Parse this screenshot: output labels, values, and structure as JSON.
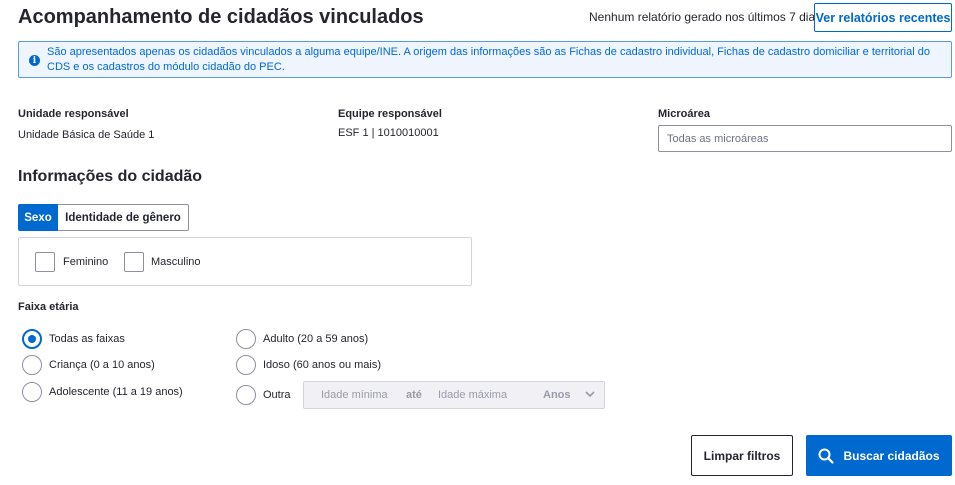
{
  "header": {
    "title": "Acompanhamento de cidadãos vinculados",
    "report_note": "Nenhum relatório gerado nos últimos 7 dias",
    "recent_reports_label": "Ver relatórios recentes"
  },
  "alert": {
    "icon": "info-icon",
    "text": "São apresentados apenas os cidadãos vinculados a alguma equipe/INE. A origem das informações são as Fichas de cadastro individual, Fichas de cadastro domiciliar e territorial do CDS e os cadastros do módulo cidadão do PEC."
  },
  "filters": {
    "unit": {
      "label": "Unidade responsável",
      "value": "Unidade Básica de Saúde 1"
    },
    "team": {
      "label": "Equipe responsável",
      "value": "ESF 1 | 1010010001"
    },
    "microarea": {
      "label": "Microárea",
      "placeholder": "Todas as microáreas"
    }
  },
  "citizen": {
    "section_title": "Informações do cidadão",
    "tabs": [
      {
        "label": "Sexo",
        "active": true
      },
      {
        "label": "Identidade de gênero",
        "active": false
      }
    ],
    "sex_options": [
      {
        "label": "Feminino",
        "checked": false
      },
      {
        "label": "Masculino",
        "checked": false
      }
    ],
    "age": {
      "label": "Faixa etária",
      "options": [
        {
          "label": "Todas as faixas",
          "checked": true
        },
        {
          "label": "Criança (0 a 10 anos)",
          "checked": false
        },
        {
          "label": "Adolescente (11 a 19 anos)",
          "checked": false
        },
        {
          "label": "Adulto (20 a 59 anos)",
          "checked": false
        },
        {
          "label": "Idoso (60 anos ou mais)",
          "checked": false
        },
        {
          "label": "Outra",
          "checked": false
        }
      ],
      "custom": {
        "min_placeholder": "Idade mínima",
        "separator": "até",
        "max_placeholder": "Idade máxima",
        "unit": "Anos"
      }
    }
  },
  "actions": {
    "clear_label": "Limpar filtros",
    "search_label": "Buscar cidadãos"
  },
  "colors": {
    "primary": "#0069d0",
    "alert_bg": "#eef5ff",
    "text": "#24252e"
  }
}
